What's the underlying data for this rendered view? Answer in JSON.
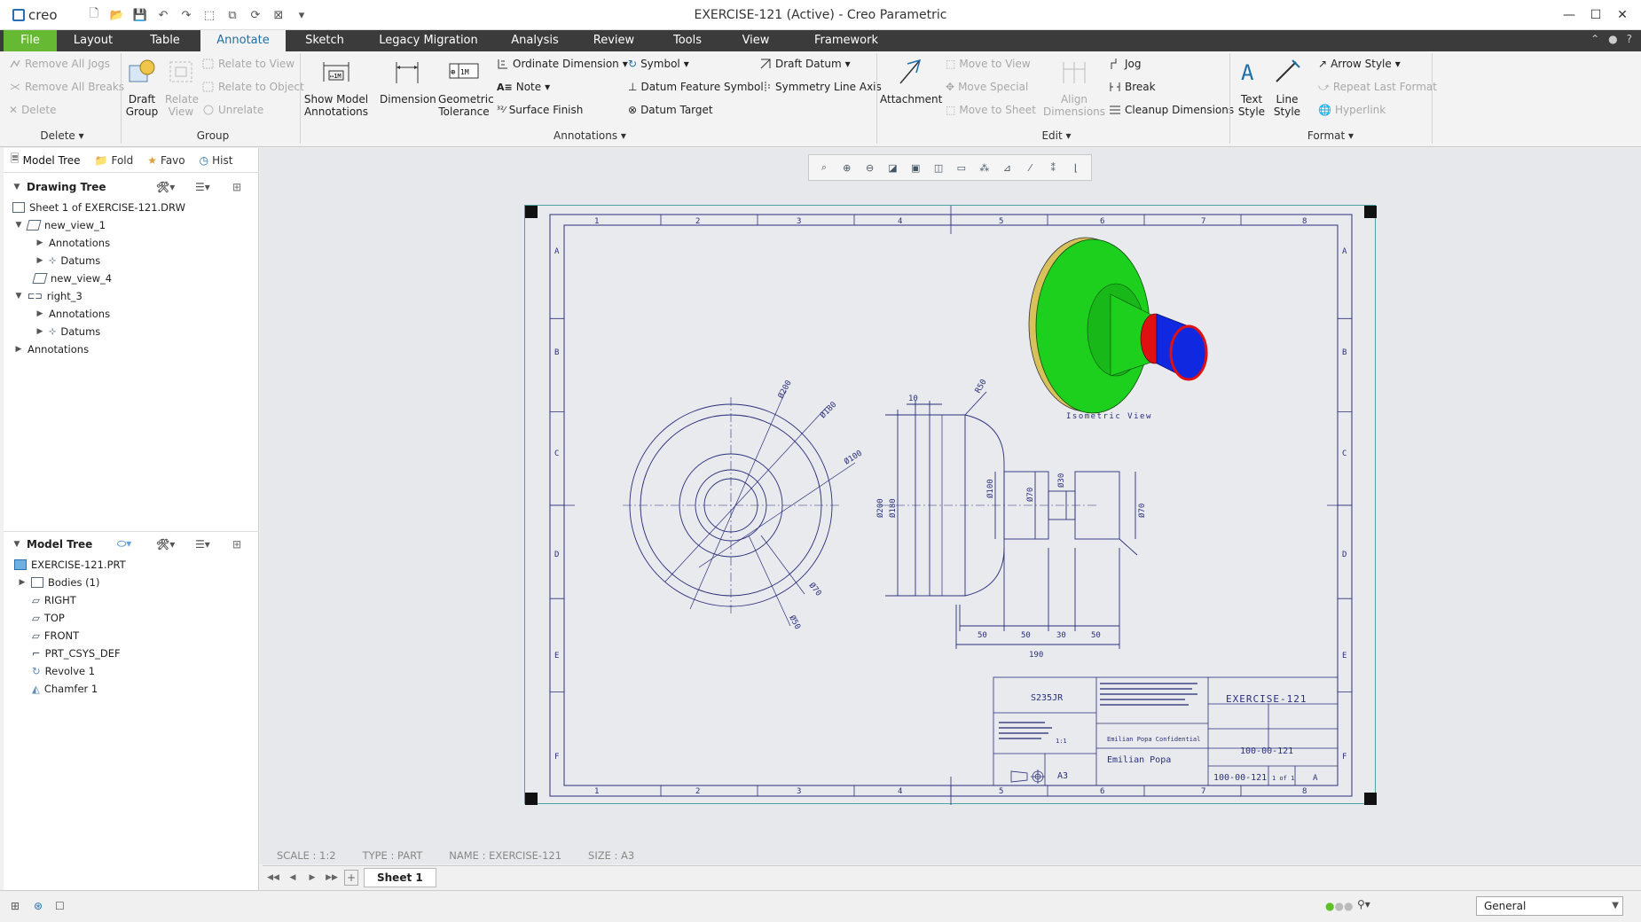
{
  "window": {
    "app_logo": "creo",
    "title": "EXERCISE-121 (Active) - Creo Parametric",
    "controls": [
      "minimize-icon",
      "maximize-icon",
      "close-icon"
    ]
  },
  "tabs": [
    {
      "label": "File",
      "state": "file"
    },
    {
      "label": "Layout"
    },
    {
      "label": "Table"
    },
    {
      "label": "Annotate",
      "state": "active"
    },
    {
      "label": "Sketch"
    },
    {
      "label": "Legacy Migration"
    },
    {
      "label": "Analysis"
    },
    {
      "label": "Review"
    },
    {
      "label": "Tools"
    },
    {
      "label": "View"
    },
    {
      "label": "Framework"
    }
  ],
  "ribbon": {
    "delete_group": {
      "remove_all_jogs": "Remove All Jogs",
      "remove_all_breaks": "Remove All Breaks",
      "delete": "Delete",
      "name": "Delete"
    },
    "group_group": {
      "draft_group": "Draft Group",
      "relate_view": "Relate View",
      "relate_to_view": "Relate to View",
      "relate_to_object": "Relate to Object",
      "unrelate": "Unrelate",
      "name": "Group"
    },
    "annotations_group": {
      "show_model_annotations": "Show Model Annotations",
      "dimension": "Dimension",
      "geometric_tolerance": "Geometric Tolerance",
      "ordinate_dimension": "Ordinate Dimension",
      "note": "Note",
      "surface_finish": "Surface Finish",
      "symbol": "Symbol",
      "datum_feature_symbol": "Datum Feature Symbol",
      "datum_target": "Datum Target",
      "draft_datum": "Draft Datum",
      "symmetry_line_axis": "Symmetry Line Axis",
      "name": "Annotations"
    },
    "edit_group": {
      "attachment": "Attachment",
      "move_to_view": "Move to View",
      "move_special": "Move Special",
      "move_to_sheet": "Move to Sheet",
      "align_dimensions": "Align Dimensions",
      "jog": "Jog",
      "break": "Break",
      "cleanup_dimensions": "Cleanup Dimensions",
      "name": "Edit"
    },
    "format_group": {
      "text_style": "Text Style",
      "line_style": "Line Style",
      "arrow_style": "Arrow Style",
      "repeat_last_format": "Repeat Last Format",
      "hyperlink": "Hyperlink",
      "name": "Format"
    }
  },
  "left_panel": {
    "tabs": [
      "Model Tree",
      "Fold",
      "Favo",
      "Hist"
    ],
    "drawing_tree": {
      "header": "Drawing Tree",
      "nodes": [
        "Sheet 1 of EXERCISE-121.DRW",
        "new_view_1",
        "Annotations",
        "Datums",
        "new_view_4",
        "right_3",
        "Annotations",
        "Datums",
        "Annotations"
      ]
    },
    "model_tree": {
      "header": "Model Tree",
      "nodes": [
        "EXERCISE-121.PRT",
        "Bodies (1)",
        "RIGHT",
        "TOP",
        "FRONT",
        "PRT_CSYS_DEF",
        "Revolve 1",
        "Chamfer 1"
      ]
    }
  },
  "drawing": {
    "zones_top": [
      "1",
      "2",
      "3",
      "4",
      "5",
      "6",
      "7",
      "8"
    ],
    "zones_side": [
      "A",
      "B",
      "C",
      "D",
      "E",
      "F"
    ],
    "dims": {
      "d200_circ": "Ø200",
      "d180_circ": "Ø180",
      "d100_circ": "Ø100",
      "d70_circ": "Ø70",
      "d50_circ": "Ø50",
      "ten": "10",
      "r50": "R50",
      "d200_side": "Ø200",
      "d180_side": "Ø180",
      "d100_side": "Ø100",
      "d70_side": "Ø70",
      "d30_side": "Ø30",
      "d70_right": "Ø70",
      "l50a": "50",
      "l50b": "50",
      "l30": "30",
      "l50c": "50",
      "l190": "190"
    },
    "isometric_label": "Isometric View",
    "title_block": {
      "material": "S235JR",
      "description": "EXERCISE-121",
      "part_number": "100-00-121",
      "drawing_number": "100-00-121",
      "drawn_by": "Emilian Popa",
      "confidential": "Emilian Popa Confidential",
      "scale_text": "1:1",
      "size": "A3",
      "sheet": "1 of 1",
      "revision": "A"
    }
  },
  "status": {
    "scale": "SCALE : 1:2",
    "type": "TYPE : PART",
    "name": "NAME : EXERCISE-121",
    "size": "SIZE : A3"
  },
  "sheet_tab": "Sheet 1",
  "filter_select": "General",
  "colors": {
    "file_tab": "#66b933",
    "tab_bar": "#3b3b3b",
    "accent": "#1c6fa8",
    "drawing_line": "#2a2f7a",
    "iso_green": "#1ed01e",
    "iso_red": "#e01010",
    "iso_blue": "#1028e0"
  }
}
